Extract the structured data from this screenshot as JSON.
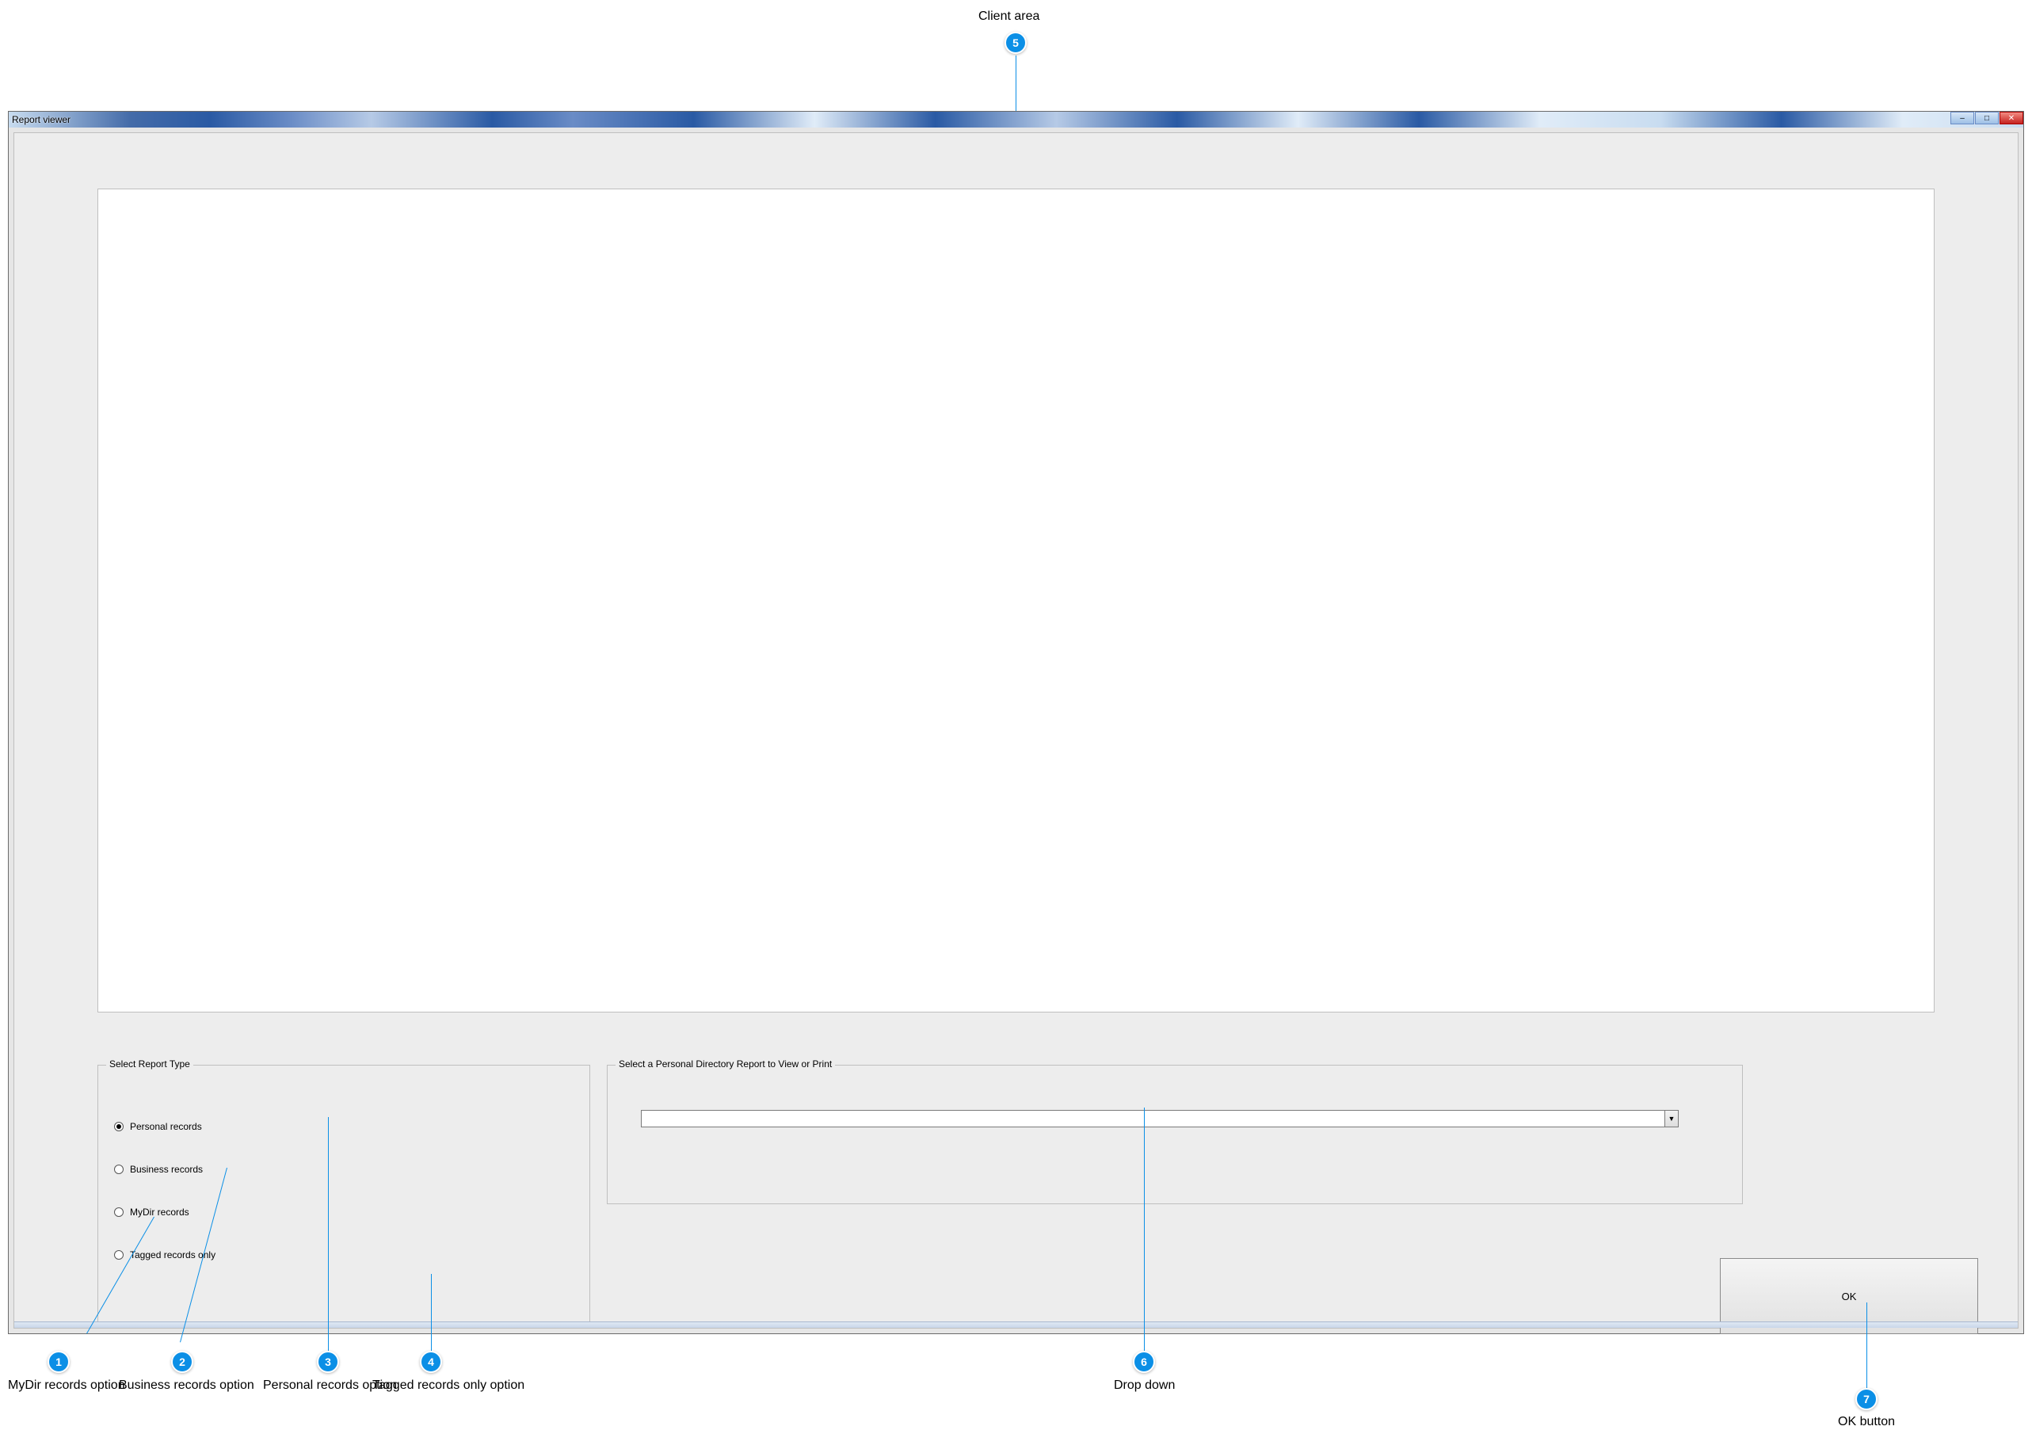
{
  "window": {
    "title": "Report viewer"
  },
  "reportTypeGroup": {
    "legend": "Select Report Type"
  },
  "directoryGroup": {
    "legend": "Select a Personal Directory Report to View or Print"
  },
  "radios": {
    "personal": "Personal records",
    "business": "Business records",
    "mydir": "MyDir records",
    "tagged": "Tagged records only"
  },
  "dropdown": {
    "selected": ""
  },
  "buttons": {
    "ok": "OK"
  },
  "callouts": {
    "1": {
      "badge": "1",
      "label": "MyDir records option"
    },
    "2": {
      "badge": "2",
      "label": "Business records option"
    },
    "3": {
      "badge": "3",
      "label": "Personal records option"
    },
    "4": {
      "badge": "4",
      "label": "Tagged records only option"
    },
    "5": {
      "badge": "5",
      "label": "Client area"
    },
    "6": {
      "badge": "6",
      "label": "Drop down"
    },
    "7": {
      "badge": "7",
      "label": "OK button"
    }
  }
}
